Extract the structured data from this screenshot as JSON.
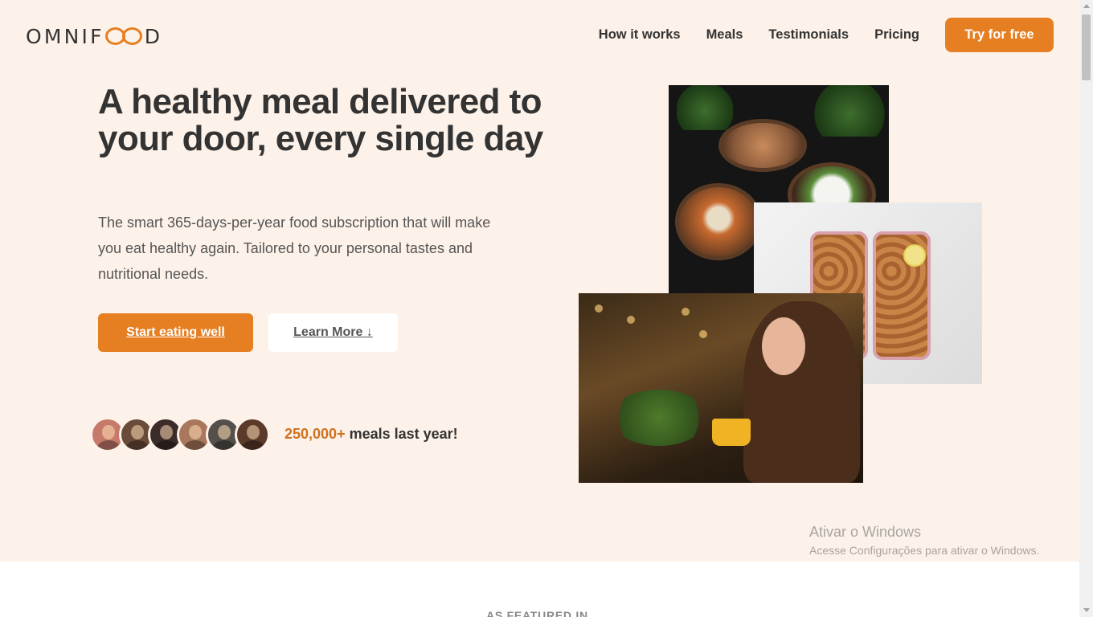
{
  "brand": {
    "logo_text": "OMNIFOOD",
    "accent_color": "#e67e22"
  },
  "nav": {
    "items": [
      {
        "label": "How it works"
      },
      {
        "label": "Meals"
      },
      {
        "label": "Testimonials"
      },
      {
        "label": "Pricing"
      }
    ],
    "cta_label": "Try for free"
  },
  "hero": {
    "title": "A healthy meal delivered to your door, every single day",
    "description": "The smart 365-days-per-year food subscription that will make you eat healthy again. Tailored to your personal tastes and nutritional needs.",
    "primary_button": "Start eating well",
    "secondary_button": "Learn More ↓",
    "meals_count": "250,000+",
    "meals_text": " meals last year!"
  },
  "customers": {
    "avatar_colors": [
      "#c77a6b",
      "#6a4b3a",
      "#3b2c2a",
      "#a8775d",
      "#54504c",
      "#5b3a2a"
    ]
  },
  "watermark": {
    "title": "Ativar o Windows",
    "subtitle": "Acesse Configurações para ativar o Windows."
  },
  "featured": {
    "label": "AS FEATURED IN"
  }
}
